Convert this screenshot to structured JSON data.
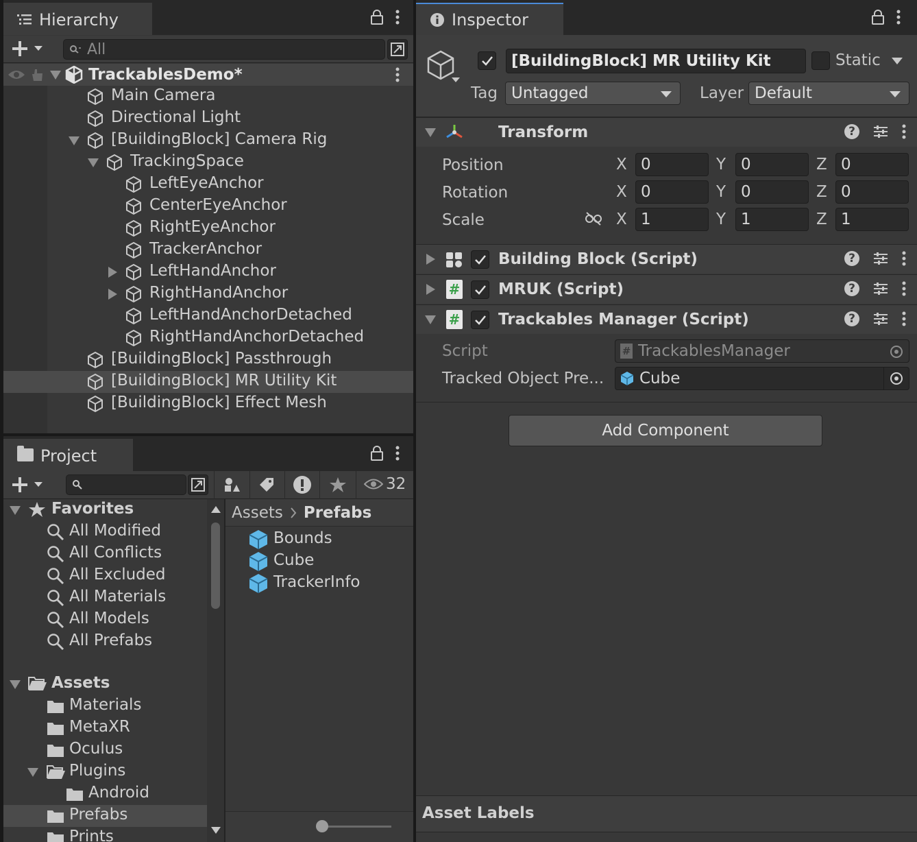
{
  "hierarchy": {
    "tab_label": "Hierarchy",
    "search_placeholder": "All",
    "scene_name": "TrackablesDemo*",
    "items": [
      {
        "label": "Main Camera"
      },
      {
        "label": "Directional Light"
      },
      {
        "label": "[BuildingBlock] Camera Rig"
      },
      {
        "label": "TrackingSpace"
      },
      {
        "label": "LeftEyeAnchor"
      },
      {
        "label": "CenterEyeAnchor"
      },
      {
        "label": "RightEyeAnchor"
      },
      {
        "label": "TrackerAnchor"
      },
      {
        "label": "LeftHandAnchor"
      },
      {
        "label": "RightHandAnchor"
      },
      {
        "label": "LeftHandAnchorDetached"
      },
      {
        "label": "RightHandAnchorDetached"
      },
      {
        "label": "[BuildingBlock] Passthrough"
      },
      {
        "label": "[BuildingBlock] MR Utility Kit"
      },
      {
        "label": "[BuildingBlock] Effect Mesh"
      }
    ],
    "selected": "[BuildingBlock] MR Utility Kit"
  },
  "project": {
    "tab_label": "Project",
    "hidden_count": "32",
    "favorites_label": "Favorites",
    "favorites": [
      "All Modified",
      "All Conflicts",
      "All Excluded",
      "All Materials",
      "All Models",
      "All Prefabs"
    ],
    "assets_label": "Assets",
    "assets_tree": [
      "Materials",
      "MetaXR",
      "Oculus",
      "Plugins",
      "Android",
      "Prefabs",
      "Prints"
    ],
    "breadcrumb": {
      "root": "Assets",
      "current": "Prefabs"
    },
    "files": [
      "Bounds",
      "Cube",
      "TrackerInfo"
    ]
  },
  "inspector": {
    "tab_label": "Inspector",
    "object_name": "[BuildingBlock] MR Utility Kit",
    "active": true,
    "static_label": "Static",
    "tag_label": "Tag",
    "tag_value": "Untagged",
    "layer_label": "Layer",
    "layer_value": "Default",
    "transform": {
      "title": "Transform",
      "position_label": "Position",
      "rotation_label": "Rotation",
      "scale_label": "Scale",
      "position": {
        "x": "0",
        "y": "0",
        "z": "0"
      },
      "rotation": {
        "x": "0",
        "y": "0",
        "z": "0"
      },
      "scale": {
        "x": "1",
        "y": "1",
        "z": "1"
      },
      "axes": {
        "x": "X",
        "y": "Y",
        "z": "Z"
      }
    },
    "components": [
      {
        "title": "Building Block (Script)"
      },
      {
        "title": "MRUK (Script)"
      },
      {
        "title": "Trackables Manager (Script)"
      }
    ],
    "trackables": {
      "script_label": "Script",
      "script_value": "TrackablesManager",
      "prefab_label": "Tracked Object Pre...",
      "prefab_value": "Cube"
    },
    "add_component": "Add Component",
    "asset_labels": "Asset Labels"
  },
  "colors": {
    "accent": "#4a8ad8",
    "panel": "#383838",
    "prefab_blue": "#5fb8e8"
  }
}
